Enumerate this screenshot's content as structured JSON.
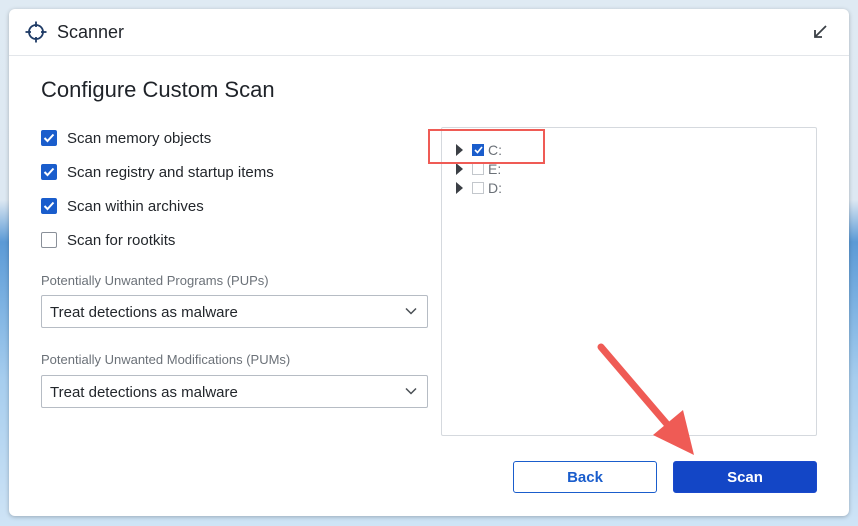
{
  "window": {
    "title": "Scanner",
    "app_icon": "crosshair-icon",
    "minimize_icon": "arrow-down-left-icon"
  },
  "page": {
    "title": "Configure Custom Scan"
  },
  "options": [
    {
      "label": "Scan memory objects",
      "checked": true
    },
    {
      "label": "Scan registry and startup items",
      "checked": true
    },
    {
      "label": "Scan within archives",
      "checked": true
    },
    {
      "label": "Scan for rootkits",
      "checked": false
    }
  ],
  "pups": {
    "label": "Potentially Unwanted Programs (PUPs)",
    "value": "Treat detections as malware"
  },
  "pums": {
    "label": "Potentially Unwanted Modifications (PUMs)",
    "value": "Treat detections as malware"
  },
  "drives": [
    {
      "label": "C:",
      "checked": true
    },
    {
      "label": "E:",
      "checked": false
    },
    {
      "label": "D:",
      "checked": false
    }
  ],
  "buttons": {
    "back": "Back",
    "scan": "Scan"
  },
  "colors": {
    "accent": "#1346c6",
    "annotation": "#ef5b55"
  }
}
